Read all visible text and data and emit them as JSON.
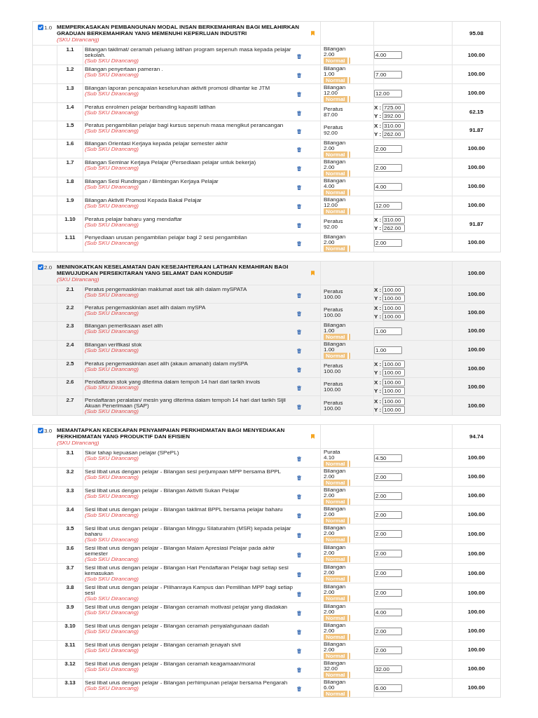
{
  "sections": [
    {
      "number": "1.0",
      "checked": true,
      "highlighted": false,
      "title": "MEMPERKASAKAN PEMBANGUNAN MODAL INSAN BERKEMAHIRAN BAGI MELAHIRKAN GRADUAN BERKEMAHIRAN YANG MEMENUHI KEPERLUAN INDUSTRI",
      "subtitle": "(SKU Dirancang)",
      "score": "95.08",
      "items": [
        {
          "number": "1.1",
          "kind": "single",
          "description": "Bilangan taklimat/ ceramah peluang latihan program sepenuh masa kepada pelajar sekolah.",
          "note": "(Sub SKU Dirancang)",
          "unit": "Bilangan",
          "target": "2.00",
          "status": "Normal",
          "value": "4.00",
          "score": "100.00"
        },
        {
          "number": "1.2",
          "kind": "single",
          "description": "Bilangan penyertaan pameran .",
          "note": "(Sub SKU Dirancang)",
          "unit": "Bilangan",
          "target": "1.00",
          "status": "Normal",
          "value": "7.00",
          "score": "100.00"
        },
        {
          "number": "1.3",
          "kind": "single",
          "description": "Bilangan laporan pencapaian keseluruhan aktiviti promosi dihantar ke JTM",
          "note": "(Sub SKU Dirancang)",
          "unit": "Bilangan",
          "target": "12.00",
          "status": "Normal",
          "value": "12.00",
          "score": "100.00"
        },
        {
          "number": "1.4",
          "kind": "ratio",
          "description": "Peratus enrolmen pelajar berbanding kapasiti latihan",
          "note": "(Sub SKU Dirancang)",
          "unit": "Peratus",
          "target": "87.00",
          "x_label": "X :",
          "x_value": "725.00",
          "y_label": "Y :",
          "y_value": "392.00",
          "score": "62.15"
        },
        {
          "number": "1.5",
          "kind": "ratio",
          "description": "Peratus pengambilan pelajar bagi kursus sepenuh masa mengikut perancangan",
          "note": "(Sub SKU Dirancang)",
          "unit": "Peratus",
          "target": "92.00",
          "x_label": "X :",
          "x_value": "310.00",
          "y_label": "Y :",
          "y_value": "262.00",
          "score": "91.87"
        },
        {
          "number": "1.6",
          "kind": "single",
          "description": "Bilangan Orientasi Kerjaya kepada pelajar semester akhir",
          "note": "(Sub SKU Dirancang)",
          "unit": "Bilangan",
          "target": "2.00",
          "status": "Normal",
          "value": "2.00",
          "score": "100.00"
        },
        {
          "number": "1.7",
          "kind": "single",
          "description": "Bilangan Seminar Kerjaya Pelajar (Persediaan pelajar untuk bekerja)",
          "note": "(Sub SKU Dirancang)",
          "unit": "Bilangan",
          "target": "2.00",
          "status": "Normal",
          "value": "2.00",
          "score": "100.00"
        },
        {
          "number": "1.8",
          "kind": "single",
          "description": "Bilangan Sesi Rundingan / Bimbingan Kerjaya Pelajar",
          "note": "(Sub SKU Dirancang)",
          "unit": "Bilangan",
          "target": "4.00",
          "status": "Normal",
          "value": "4.00",
          "score": "100.00"
        },
        {
          "number": "1.9",
          "kind": "single",
          "description": "Bilangan Aktiviti Promosi Kepada Bakal Pelajar",
          "note": "(Sub SKU Dirancang)",
          "unit": "Bilangan",
          "target": "12.00",
          "status": "Normal",
          "value": "12.00",
          "score": "100.00"
        },
        {
          "number": "1.10",
          "kind": "ratio",
          "description": "Peratus pelajar baharu yang mendaftar",
          "note": "(Sub SKU Dirancang)",
          "unit": "Peratus",
          "target": "92.00",
          "x_label": "X :",
          "x_value": "310.00",
          "y_label": "Y :",
          "y_value": "262.00",
          "score": "91.87"
        },
        {
          "number": "1.11",
          "kind": "single",
          "description": "Penyediaan urusan pengambilan pelajar bagi 2 sesi pengambilan",
          "note": "(Sub SKU Dirancang)",
          "unit": "Bilangan",
          "target": "2.00",
          "status": "Normal",
          "value": "2.00",
          "score": "100.00"
        }
      ]
    },
    {
      "number": "2.0",
      "checked": true,
      "highlighted": true,
      "title": "MENINGKATKAN KESELAMATAN DAN KESEJAHTERAAN LATIHAN KEMAHIRAN BAGI MEWUJUDKAN PERSEKITARAN YANG SELAMAT DAN KONDUSIF",
      "subtitle": "(SKU Dirancang)",
      "score": "100.00",
      "items": [
        {
          "number": "2.1",
          "kind": "ratio",
          "description": "Peratus pengemaskinian maklumat aset tak alih dalam mySPATA",
          "note": "(Sub SKU Dirancang)",
          "unit": "Peratus",
          "target": "100.00",
          "x_label": "X :",
          "x_value": "100.00",
          "y_label": "Y :",
          "y_value": "100.00",
          "score": "100.00"
        },
        {
          "number": "2.2",
          "kind": "ratio",
          "description": "Peratus pengemaskinian aset alih dalam mySPA",
          "note": "(Sub SKU Dirancang)",
          "unit": "Peratus",
          "target": "100.00",
          "x_label": "X :",
          "x_value": "100.00",
          "y_label": "Y :",
          "y_value": "100.00",
          "score": "100.00"
        },
        {
          "number": "2.3",
          "kind": "single",
          "description": "Bilangan pemeriksaan aset alih",
          "note": "(Sub SKU Dirancang)",
          "unit": "Bilangan",
          "target": "1.00",
          "status": "Normal",
          "value": "1.00",
          "score": "100.00"
        },
        {
          "number": "2.4",
          "kind": "single",
          "description": "Bilangan verifikasi stok",
          "note": "(Sub SKU Dirancang)",
          "unit": "Bilangan",
          "target": "1.00",
          "status": "Normal",
          "value": "1.00",
          "score": "100.00"
        },
        {
          "number": "2.5",
          "kind": "ratio",
          "description": "Peratus pengemaskinian aset alih (akaun amanah) dalam mySPA",
          "note": "(Sub SKU Dirancang)",
          "unit": "Peratus",
          "target": "100.00",
          "x_label": "X :",
          "x_value": "100.00",
          "y_label": "Y :",
          "y_value": "100.00",
          "score": "100.00"
        },
        {
          "number": "2.6",
          "kind": "ratio",
          "description": "Pendaftaran stok yang diterima dalam tempoh 14 hari dari tarikh invois",
          "note": "(Sub SKU Dirancang)",
          "unit": "Peratus",
          "target": "100.00",
          "x_label": "X :",
          "x_value": "100.00",
          "y_label": "Y :",
          "y_value": "100.00",
          "score": "100.00"
        },
        {
          "number": "2.7",
          "kind": "ratio",
          "description": "Pendaftaran peralatan/ mesin yang diterima dalam tempoh 14 hari dari tarikh Sijil Akuan Penerimaan (SAP)",
          "note": "(Sub SKU Dirancang)",
          "unit": "Peratus",
          "target": "100.00",
          "x_label": "X :",
          "x_value": "100.00",
          "y_label": "Y :",
          "y_value": "100.00",
          "score": "100.00"
        }
      ]
    },
    {
      "number": "3.0",
      "checked": true,
      "highlighted": false,
      "title": "MEMANTAPKAN KECEKAPAN PENYAMPAIAN PERKHIDMATAN BAGI MENYEDIAKAN PERKHIDMATAN YANG PRODUKTIF DAN EFISIEN",
      "subtitle": "(SKU Dirancang)",
      "score": "94.74",
      "items": [
        {
          "number": "3.1",
          "kind": "single",
          "description": "Skor tahap kepuasan pelajar (SPePL)",
          "note": "(Sub SKU Dirancang)",
          "unit": "Purata",
          "target": "4.10",
          "status": "Normal",
          "value": "4.50",
          "score": "100.00"
        },
        {
          "number": "3.2",
          "kind": "single",
          "description": "Sesi libat urus dengan pelajar - Bilangan sesi perjumpaan MPP bersama BPPL",
          "note": "(Sub SKU Dirancang)",
          "unit": "Bilangan",
          "target": "2.00",
          "status": "Normal",
          "value": "2.00",
          "score": "100.00"
        },
        {
          "number": "3.3",
          "kind": "single",
          "description": "Sesi libat urus dengan pelajar - Bilangan Aktiviti Sukan Pelajar",
          "note": "(Sub SKU Dirancang)",
          "unit": "Bilangan",
          "target": "2.00",
          "status": "Normal",
          "value": "2.00",
          "score": "100.00"
        },
        {
          "number": "3.4",
          "kind": "single",
          "description": "Sesi libat urus dengan pelajar - Bilangan taklimat BPPL bersama pelajar baharu",
          "note": "(Sub SKU Dirancang)",
          "unit": "Bilangan",
          "target": "2.00",
          "status": "Normal",
          "value": "2.00",
          "score": "100.00"
        },
        {
          "number": "3.5",
          "kind": "single",
          "description": "Sesi libat urus dengan pelajar - Bilangan Minggu Silaturahim (MSR) kepada pelajar baharu",
          "note": "(Sub SKU Dirancang)",
          "unit": "Bilangan",
          "target": "2.00",
          "status": "Normal",
          "value": "2.00",
          "score": "100.00"
        },
        {
          "number": "3.6",
          "kind": "single",
          "description": "Sesi libat urus dengan pelajar - Bilangan Malam Apresiasi Pelajar pada akhir semester",
          "note": "(Sub SKU Dirancang)",
          "unit": "Bilangan",
          "target": "2.00",
          "status": "Normal",
          "value": "2.00",
          "score": "100.00"
        },
        {
          "number": "3.7",
          "kind": "single",
          "description": "Sesi libat urus dengan pelajar - Bilangan Hari Pendaftaran Pelajar bagi setiap sesi kemasukan",
          "note": "(Sub SKU Dirancang)",
          "unit": "Bilangan",
          "target": "2.00",
          "status": "Normal",
          "value": "2.00",
          "score": "100.00"
        },
        {
          "number": "3.8",
          "kind": "single",
          "description": "Sesi libat urus dengan pelajar - Pilihanraya Kampus dan Pemilihan MPP bagi setiap sesi",
          "note": "(Sub SKU Dirancang)",
          "unit": "Bilangan",
          "target": "2.00",
          "status": "Normal",
          "value": "2.00",
          "score": "100.00"
        },
        {
          "number": "3.9",
          "kind": "single",
          "description": "Sesi libat urus dengan pelajar - Bilangan ceramah motivasi pelajar yang diadakan",
          "note": "(Sub SKU Dirancang)",
          "unit": "Bilangan",
          "target": "2.00",
          "status": "Normal",
          "value": "4.00",
          "score": "100.00"
        },
        {
          "number": "3.10",
          "kind": "single",
          "description": "Sesi libat urus dengan pelajar - Bilangan ceramah penyalahgunaan dadah",
          "note": "(Sub SKU Dirancang)",
          "unit": "Bilangan",
          "target": "2.00",
          "status": "Normal",
          "value": "2.00",
          "score": "100.00"
        },
        {
          "number": "3.11",
          "kind": "single",
          "description": "Sesi libat urus dengan pelajar - Bilangan ceramah jenayah sivil",
          "note": "(Sub SKU Dirancang)",
          "unit": "Bilangan",
          "target": "2.00",
          "status": "Normal",
          "value": "2.00",
          "score": "100.00"
        },
        {
          "number": "3.12",
          "kind": "single",
          "description": "Sesi libat urus dengan pelajar - Bilangan ceramah keagamaan/moral",
          "note": "(Sub SKU Dirancang)",
          "unit": "Bilangan",
          "target": "32.00",
          "status": "Normal",
          "value": "32.00",
          "score": "100.00"
        },
        {
          "number": "3.13",
          "kind": "single",
          "description": "Sesi libat urus dengan pelajar - Bilangan perhimpunan pelajar bersama Pengarah",
          "note": "(Sub SKU Dirancang)",
          "unit": "Bilangan",
          "target": "6.00",
          "status": "Normal",
          "value": "6.00",
          "score": "100.00"
        }
      ]
    }
  ]
}
